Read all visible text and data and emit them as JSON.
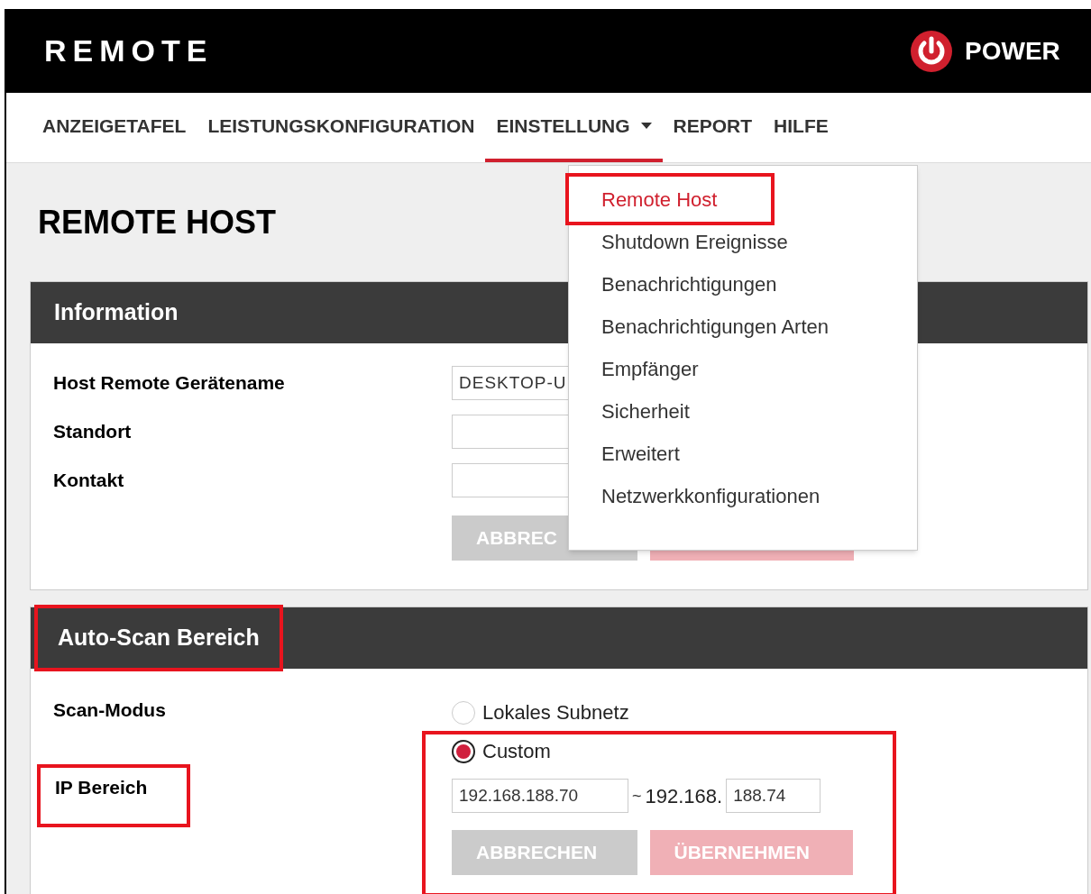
{
  "header": {
    "title": "REMOTE",
    "brand": "POWER"
  },
  "nav": [
    {
      "label": "ANZEIGETAFEL",
      "kind": "link",
      "selected": false
    },
    {
      "label": "LEISTUNGSKONFIGURATION",
      "kind": "link",
      "selected": false
    },
    {
      "label": "EINSTELLUNG",
      "kind": "menu",
      "selected": true
    },
    {
      "label": "REPORT",
      "kind": "link",
      "selected": false
    },
    {
      "label": "HILFE",
      "kind": "link",
      "selected": false
    }
  ],
  "dropdown": {
    "items": [
      {
        "label": "Remote Host",
        "selected": true,
        "highlighted": true
      },
      {
        "label": "Shutdown Ereignisse",
        "selected": false,
        "highlighted": false
      },
      {
        "label": "Benachrichtigungen",
        "selected": false,
        "highlighted": false
      },
      {
        "label": "Benachrichtigungen Arten",
        "selected": false,
        "highlighted": false
      },
      {
        "label": "Empfänger",
        "selected": false,
        "highlighted": false
      },
      {
        "label": "Sicherheit",
        "selected": false,
        "highlighted": false
      },
      {
        "label": "Erweitert",
        "selected": false,
        "highlighted": false
      },
      {
        "label": "Netzwerkkonfigurationen",
        "selected": false,
        "highlighted": false
      }
    ]
  },
  "page_title": "REMOTE HOST",
  "information": {
    "title": "Information",
    "highlighted": false,
    "fields": [
      {
        "label": "Host Remote Gerätename",
        "value": "DESKTOP-U"
      },
      {
        "label": "Standort"
      },
      {
        "label": "Kontakt"
      }
    ],
    "buttons": [
      {
        "label": "ABBREC",
        "kind": "cancel"
      },
      {
        "kind": "apply"
      }
    ]
  },
  "auto_scan": {
    "title": "Auto-Scan Bereich",
    "highlighted": true,
    "scan_mode_label": "Scan-Modus",
    "options": [
      {
        "label": "Lokales Subnetz",
        "selected": false
      },
      {
        "label": "Custom",
        "selected": true
      }
    ],
    "custom_highlighted": true,
    "ip_label": "IP Bereich",
    "ip_label_highlighted": true,
    "ip_start": "192.168.188.70",
    "ip_separator": "~",
    "ip_prefix": "192.168.",
    "ip_end": "188.74",
    "buttons": [
      {
        "label": "ABBRECHEN",
        "kind": "cancel"
      },
      {
        "label": "ÜBERNEHMEN",
        "kind": "apply"
      }
    ]
  }
}
